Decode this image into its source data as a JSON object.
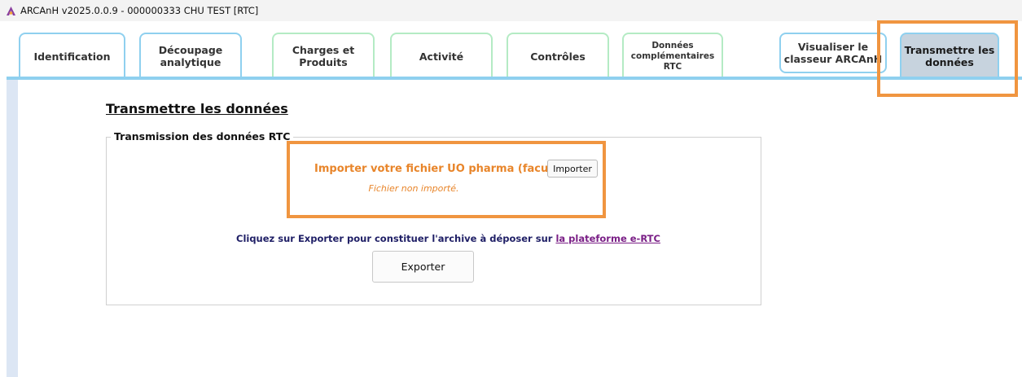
{
  "window": {
    "title": "ARCAnH v2025.0.0.9 - 000000333 CHU TEST [RTC]",
    "icon": "arcanh-app-icon"
  },
  "tabs": [
    {
      "label": "Identification",
      "style": "blue"
    },
    {
      "label": "Découpage\nanalytique",
      "style": "blue"
    },
    {
      "label": "Charges et\nProduits",
      "style": "green"
    },
    {
      "label": "Activité",
      "style": "green"
    },
    {
      "label": "Contrôles",
      "style": "green"
    },
    {
      "label": "Données\ncomplémentaires\nRTC",
      "style": "green"
    },
    {
      "label": "Visualiser le\nclasseur ARCAnH",
      "style": "blue"
    },
    {
      "label": "Transmettre les\ndonnées",
      "style": "active"
    }
  ],
  "main": {
    "section_title": "Transmettre les données",
    "fieldset_legend": "Transmission des données RTC",
    "import_label": "Importer votre fichier UO pharma (facultatif)",
    "import_button": "Importer",
    "import_status": "Fichier non importé.",
    "export_instruction": "Cliquez sur Exporter pour constituer l'archive à déposer sur",
    "export_link": "la plateforme e-RTC",
    "export_button": "Exporter"
  },
  "colors": {
    "tab_border_blue": "#8fd0ef",
    "tab_border_green": "#b4ebc4",
    "tab_active_bg": "#c7d3de",
    "highlight_orange": "#f09540",
    "import_text_orange": "#e8852a",
    "link_purple": "#7a1f86",
    "instruction_navy": "#1f1f66"
  }
}
